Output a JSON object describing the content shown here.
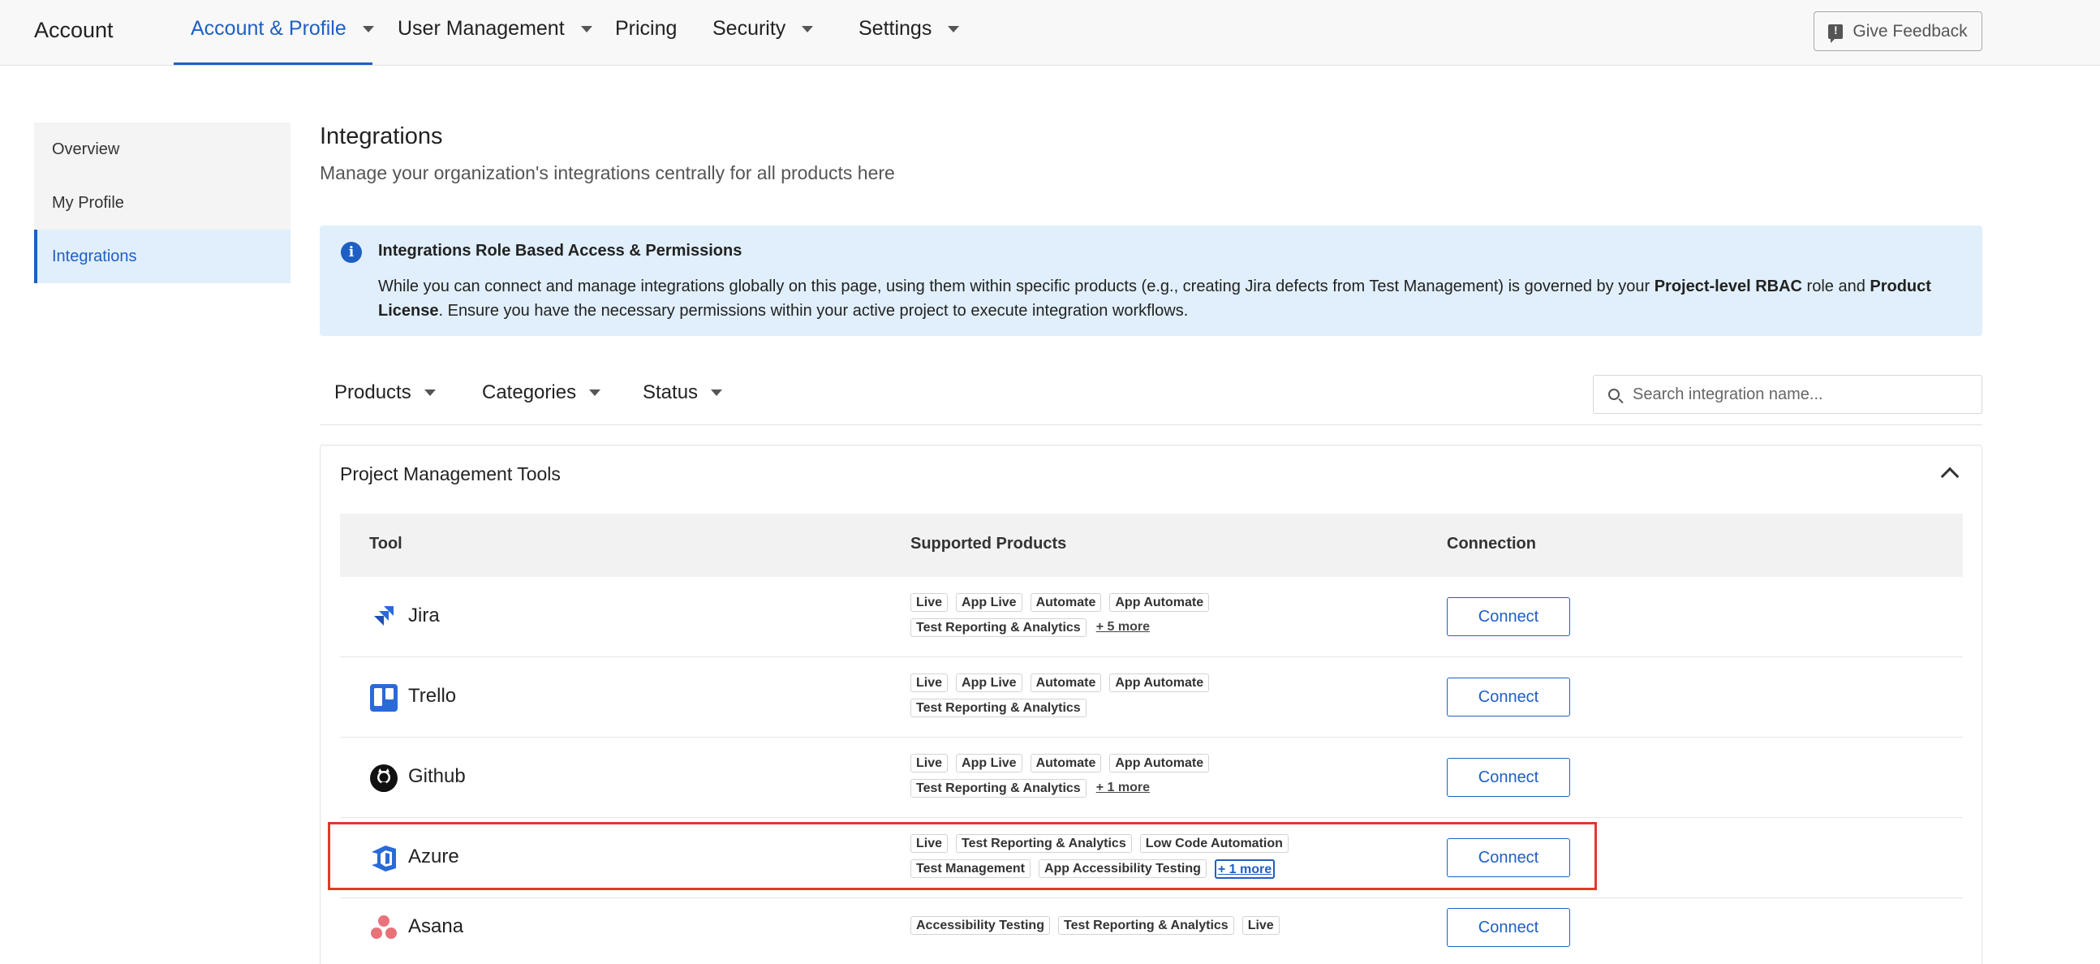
{
  "header": {
    "brand": "Account",
    "nav": [
      {
        "label": "Account & Profile"
      },
      {
        "label": "User Management"
      },
      {
        "label": "Pricing"
      },
      {
        "label": "Security"
      },
      {
        "label": "Settings"
      }
    ],
    "feedback_label": "Give Feedback"
  },
  "sidebar": {
    "items": [
      {
        "label": "Overview"
      },
      {
        "label": "My Profile"
      },
      {
        "label": "Integrations"
      }
    ]
  },
  "main": {
    "title": "Integrations",
    "subtitle": "Manage your organization's integrations centrally for all products here",
    "banner": {
      "title": "Integrations Role Based Access & Permissions",
      "text1": "While you can connect and manage integrations globally on this page, using them within specific products (e.g., creating Jira defects from Test Management) is governed by your ",
      "bold1": "Project-level RBAC",
      "text2": " role and ",
      "bold2": "Product License",
      "text3": ". Ensure you have the necessary permissions within your active project to execute integration workflows."
    },
    "filters": {
      "products": "Products",
      "categories": "Categories",
      "status": "Status",
      "search_placeholder": "Search integration name..."
    },
    "panel": {
      "title": "Project Management Tools",
      "headers": {
        "tool": "Tool",
        "supported": "Supported Products",
        "connection": "Connection"
      },
      "connect_label": "Connect",
      "rows": [
        {
          "name": "Jira",
          "icon": "jira-icon",
          "line1": [
            "Live",
            "App Live",
            "Automate",
            "App Automate"
          ],
          "line2": [
            "Test Reporting & Analytics"
          ],
          "more": "+ 5 more"
        },
        {
          "name": "Trello",
          "icon": "trello-icon",
          "line1": [
            "Live",
            "App Live",
            "Automate",
            "App Automate"
          ],
          "line2": [
            "Test Reporting & Analytics"
          ],
          "more": ""
        },
        {
          "name": "Github",
          "icon": "github-icon",
          "line1": [
            "Live",
            "App Live",
            "Automate",
            "App Automate"
          ],
          "line2": [
            "Test Reporting & Analytics"
          ],
          "more": "+ 1 more"
        },
        {
          "name": "Azure",
          "icon": "azure-icon",
          "line1": [
            "Live",
            "Test Reporting & Analytics",
            "Low Code Automation"
          ],
          "line2": [
            "Test Management",
            "App Accessibility Testing"
          ],
          "more": "+ 1 more"
        },
        {
          "name": "Asana",
          "icon": "asana-icon",
          "line1": [
            "Accessibility Testing",
            "Test Reporting & Analytics",
            "Live"
          ],
          "line2": [],
          "more": ""
        }
      ]
    }
  },
  "colors": {
    "accent": "#1f5fc4",
    "banner_bg": "#e0effb",
    "highlight": "#e0392b"
  }
}
